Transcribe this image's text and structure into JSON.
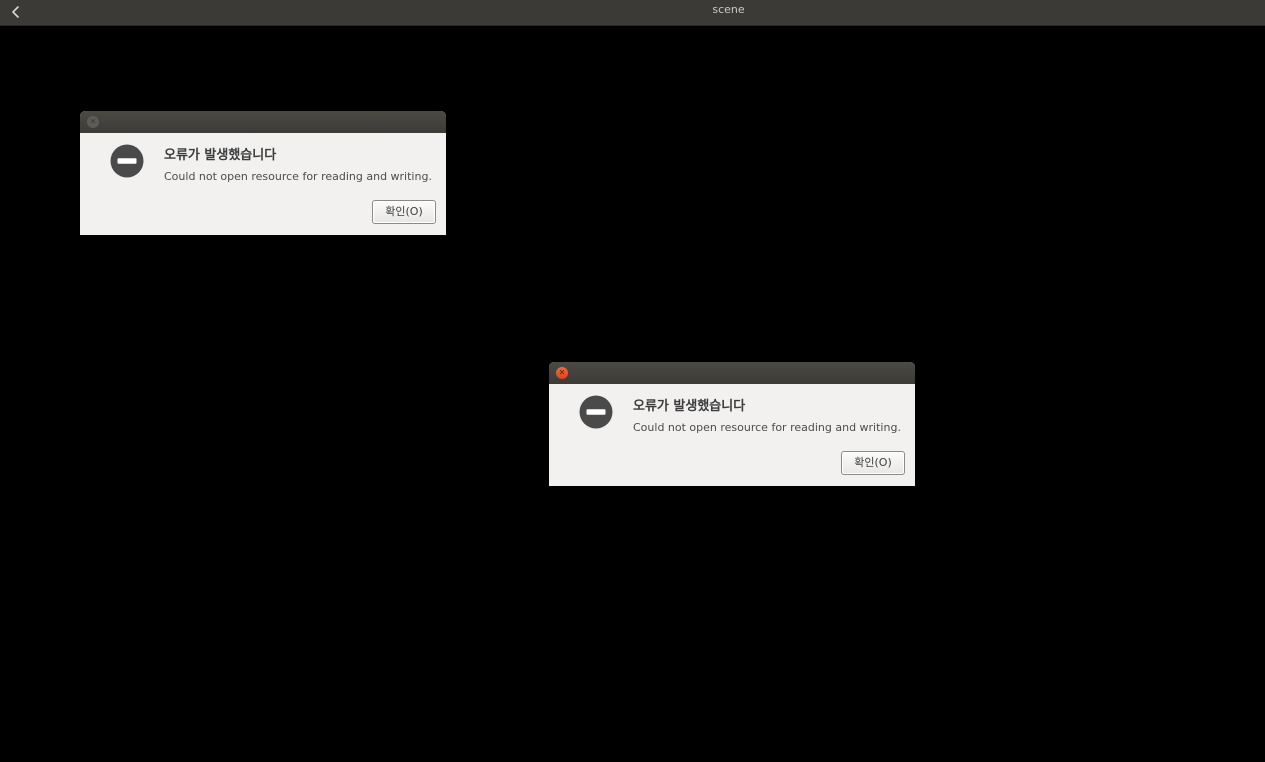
{
  "app": {
    "title": "scene",
    "back_icon": "chevron-left-icon"
  },
  "dialogs": [
    {
      "state": "inactive",
      "close_icon": "close-icon",
      "error_icon": "error-minus-circle-icon",
      "heading": "오류가 발생했습니다",
      "message": "Could not open resource for reading and writing.",
      "ok_label": "확인(O)"
    },
    {
      "state": "active",
      "close_icon": "close-icon",
      "error_icon": "error-minus-circle-icon",
      "heading": "오류가 발생했습니다",
      "message": "Could not open resource for reading and writing.",
      "ok_label": "확인(O)"
    }
  ],
  "colors": {
    "topbar": "#3b3a36",
    "dialog_titlebar": "#3c3b37",
    "dialog_body": "#f2f1f0",
    "close_active": "#e95420",
    "error_icon": "#4a4a4a"
  }
}
